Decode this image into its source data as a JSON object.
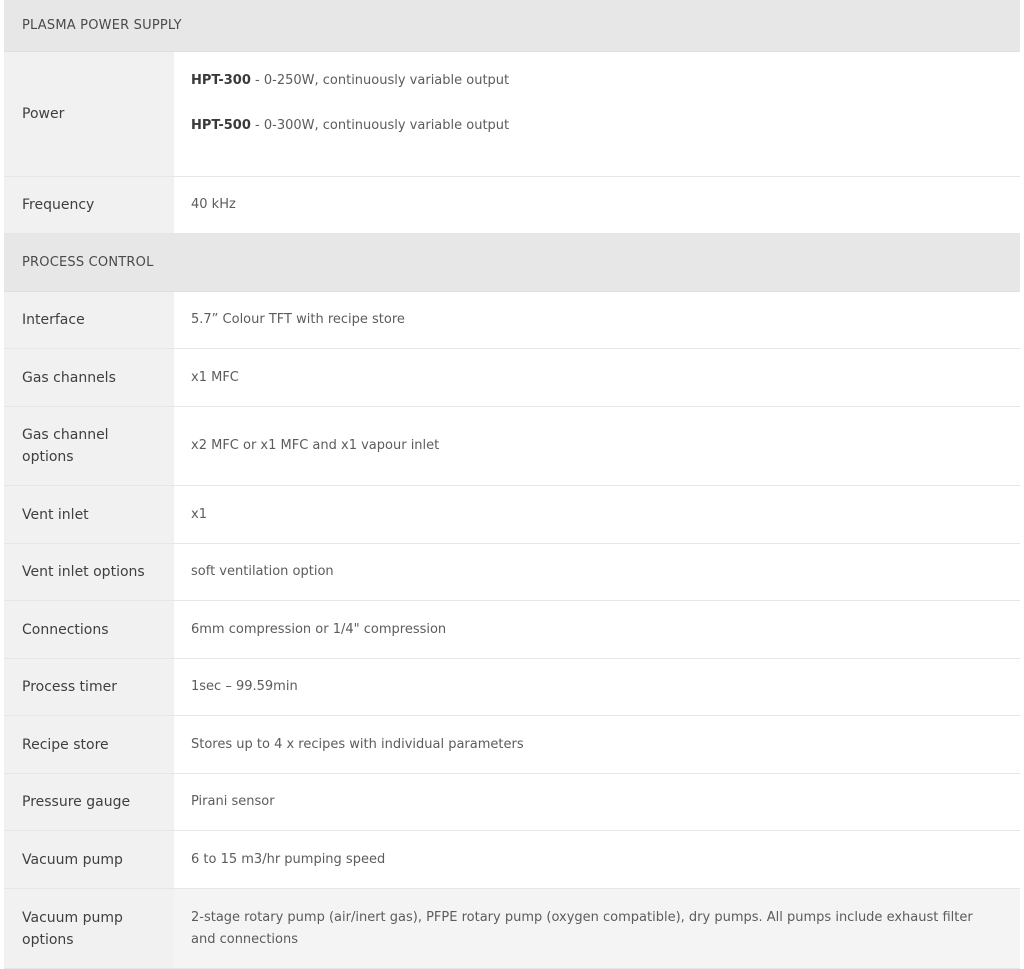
{
  "sections": [
    {
      "title": "PLASMA POWER SUPPLY",
      "rows": [
        {
          "label": "Power",
          "lines": [
            {
              "model": "HPT-300",
              "text": " - 0-250W, continuously variable output"
            },
            {
              "model": "HPT-500",
              "text": " - 0-300W, continuously variable output"
            }
          ]
        },
        {
          "label": "Frequency",
          "value": "40 kHz"
        }
      ]
    },
    {
      "title": "PROCESS CONTROL",
      "rows": [
        {
          "label": "Interface",
          "value": "5.7” Colour TFT with recipe store"
        },
        {
          "label": "Gas channels",
          "value": "x1 MFC"
        },
        {
          "label": "Gas channel options",
          "value": "x2 MFC or x1 MFC and x1 vapour inlet"
        },
        {
          "label": "Vent inlet",
          "value": "x1"
        },
        {
          "label": "Vent inlet options",
          "value": "soft ventilation option"
        },
        {
          "label": "Connections",
          "value": "6mm compression or 1/4\" compression"
        },
        {
          "label": "Process timer",
          "value": "1sec – 99.59min"
        },
        {
          "label": "Recipe store",
          "value": "Stores up to 4 x recipes with individual parameters"
        },
        {
          "label": "Pressure gauge",
          "value": "Pirani sensor"
        },
        {
          "label": "Vacuum pump",
          "value": "6 to 15 m3/hr pumping speed"
        },
        {
          "label": "Vacuum pump options",
          "value": "2-stage rotary pump (air/inert gas), PFPE rotary pump (oxygen compatible), dry pumps. All pumps include exhaust filter and connections"
        }
      ]
    }
  ]
}
